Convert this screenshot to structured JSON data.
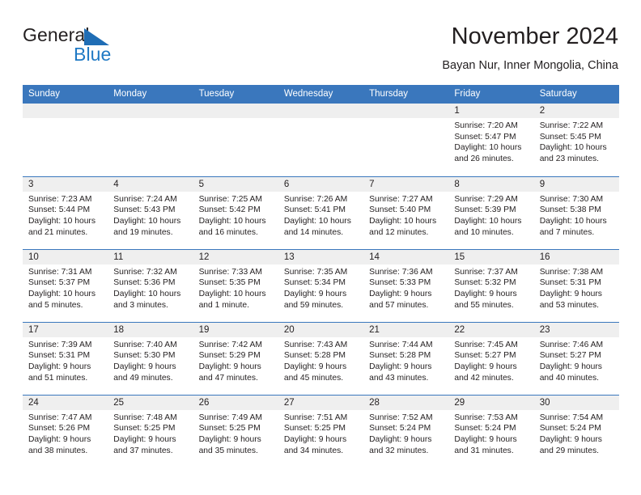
{
  "brand": {
    "line1": "General",
    "line2": "Blue",
    "triangle_color": "#1f6db5",
    "blue_color": "#1f79c4"
  },
  "header": {
    "title": "November 2024",
    "subtitle": "Bayan Nur, Inner Mongolia, China"
  },
  "theme": {
    "header_blue": "#3a77bd",
    "date_band_gray": "#efefef",
    "text": "#231f20"
  },
  "calendar": {
    "weekday_headers": [
      "Sunday",
      "Monday",
      "Tuesday",
      "Wednesday",
      "Thursday",
      "Friday",
      "Saturday"
    ],
    "weeks": [
      [
        {
          "date": "",
          "empty": true
        },
        {
          "date": "",
          "empty": true
        },
        {
          "date": "",
          "empty": true
        },
        {
          "date": "",
          "empty": true
        },
        {
          "date": "",
          "empty": true
        },
        {
          "date": "1",
          "sunrise": "Sunrise: 7:20 AM",
          "sunset": "Sunset: 5:47 PM",
          "daylight": "Daylight: 10 hours and 26 minutes."
        },
        {
          "date": "2",
          "sunrise": "Sunrise: 7:22 AM",
          "sunset": "Sunset: 5:45 PM",
          "daylight": "Daylight: 10 hours and 23 minutes."
        }
      ],
      [
        {
          "date": "3",
          "sunrise": "Sunrise: 7:23 AM",
          "sunset": "Sunset: 5:44 PM",
          "daylight": "Daylight: 10 hours and 21 minutes."
        },
        {
          "date": "4",
          "sunrise": "Sunrise: 7:24 AM",
          "sunset": "Sunset: 5:43 PM",
          "daylight": "Daylight: 10 hours and 19 minutes."
        },
        {
          "date": "5",
          "sunrise": "Sunrise: 7:25 AM",
          "sunset": "Sunset: 5:42 PM",
          "daylight": "Daylight: 10 hours and 16 minutes."
        },
        {
          "date": "6",
          "sunrise": "Sunrise: 7:26 AM",
          "sunset": "Sunset: 5:41 PM",
          "daylight": "Daylight: 10 hours and 14 minutes."
        },
        {
          "date": "7",
          "sunrise": "Sunrise: 7:27 AM",
          "sunset": "Sunset: 5:40 PM",
          "daylight": "Daylight: 10 hours and 12 minutes."
        },
        {
          "date": "8",
          "sunrise": "Sunrise: 7:29 AM",
          "sunset": "Sunset: 5:39 PM",
          "daylight": "Daylight: 10 hours and 10 minutes."
        },
        {
          "date": "9",
          "sunrise": "Sunrise: 7:30 AM",
          "sunset": "Sunset: 5:38 PM",
          "daylight": "Daylight: 10 hours and 7 minutes."
        }
      ],
      [
        {
          "date": "10",
          "sunrise": "Sunrise: 7:31 AM",
          "sunset": "Sunset: 5:37 PM",
          "daylight": "Daylight: 10 hours and 5 minutes."
        },
        {
          "date": "11",
          "sunrise": "Sunrise: 7:32 AM",
          "sunset": "Sunset: 5:36 PM",
          "daylight": "Daylight: 10 hours and 3 minutes."
        },
        {
          "date": "12",
          "sunrise": "Sunrise: 7:33 AM",
          "sunset": "Sunset: 5:35 PM",
          "daylight": "Daylight: 10 hours and 1 minute."
        },
        {
          "date": "13",
          "sunrise": "Sunrise: 7:35 AM",
          "sunset": "Sunset: 5:34 PM",
          "daylight": "Daylight: 9 hours and 59 minutes."
        },
        {
          "date": "14",
          "sunrise": "Sunrise: 7:36 AM",
          "sunset": "Sunset: 5:33 PM",
          "daylight": "Daylight: 9 hours and 57 minutes."
        },
        {
          "date": "15",
          "sunrise": "Sunrise: 7:37 AM",
          "sunset": "Sunset: 5:32 PM",
          "daylight": "Daylight: 9 hours and 55 minutes."
        },
        {
          "date": "16",
          "sunrise": "Sunrise: 7:38 AM",
          "sunset": "Sunset: 5:31 PM",
          "daylight": "Daylight: 9 hours and 53 minutes."
        }
      ],
      [
        {
          "date": "17",
          "sunrise": "Sunrise: 7:39 AM",
          "sunset": "Sunset: 5:31 PM",
          "daylight": "Daylight: 9 hours and 51 minutes."
        },
        {
          "date": "18",
          "sunrise": "Sunrise: 7:40 AM",
          "sunset": "Sunset: 5:30 PM",
          "daylight": "Daylight: 9 hours and 49 minutes."
        },
        {
          "date": "19",
          "sunrise": "Sunrise: 7:42 AM",
          "sunset": "Sunset: 5:29 PM",
          "daylight": "Daylight: 9 hours and 47 minutes."
        },
        {
          "date": "20",
          "sunrise": "Sunrise: 7:43 AM",
          "sunset": "Sunset: 5:28 PM",
          "daylight": "Daylight: 9 hours and 45 minutes."
        },
        {
          "date": "21",
          "sunrise": "Sunrise: 7:44 AM",
          "sunset": "Sunset: 5:28 PM",
          "daylight": "Daylight: 9 hours and 43 minutes."
        },
        {
          "date": "22",
          "sunrise": "Sunrise: 7:45 AM",
          "sunset": "Sunset: 5:27 PM",
          "daylight": "Daylight: 9 hours and 42 minutes."
        },
        {
          "date": "23",
          "sunrise": "Sunrise: 7:46 AM",
          "sunset": "Sunset: 5:27 PM",
          "daylight": "Daylight: 9 hours and 40 minutes."
        }
      ],
      [
        {
          "date": "24",
          "sunrise": "Sunrise: 7:47 AM",
          "sunset": "Sunset: 5:26 PM",
          "daylight": "Daylight: 9 hours and 38 minutes."
        },
        {
          "date": "25",
          "sunrise": "Sunrise: 7:48 AM",
          "sunset": "Sunset: 5:25 PM",
          "daylight": "Daylight: 9 hours and 37 minutes."
        },
        {
          "date": "26",
          "sunrise": "Sunrise: 7:49 AM",
          "sunset": "Sunset: 5:25 PM",
          "daylight": "Daylight: 9 hours and 35 minutes."
        },
        {
          "date": "27",
          "sunrise": "Sunrise: 7:51 AM",
          "sunset": "Sunset: 5:25 PM",
          "daylight": "Daylight: 9 hours and 34 minutes."
        },
        {
          "date": "28",
          "sunrise": "Sunrise: 7:52 AM",
          "sunset": "Sunset: 5:24 PM",
          "daylight": "Daylight: 9 hours and 32 minutes."
        },
        {
          "date": "29",
          "sunrise": "Sunrise: 7:53 AM",
          "sunset": "Sunset: 5:24 PM",
          "daylight": "Daylight: 9 hours and 31 minutes."
        },
        {
          "date": "30",
          "sunrise": "Sunrise: 7:54 AM",
          "sunset": "Sunset: 5:24 PM",
          "daylight": "Daylight: 9 hours and 29 minutes."
        }
      ]
    ]
  }
}
